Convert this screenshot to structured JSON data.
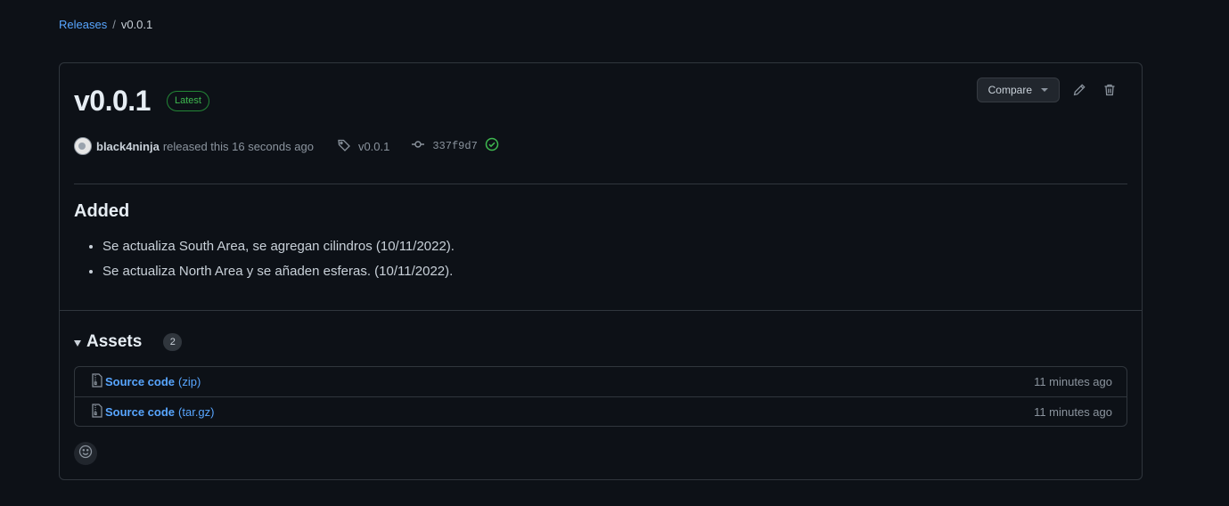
{
  "breadcrumb": {
    "parent": "Releases",
    "separator": "/",
    "current": "v0.0.1"
  },
  "release": {
    "title": "v0.0.1",
    "badge": "Latest",
    "author": "black4ninja",
    "released_text": "released this 16 seconds ago",
    "tag": "v0.0.1",
    "commit": "337f9d7",
    "commit_status": "verified"
  },
  "actions": {
    "compare_label": "Compare",
    "edit_icon": "pencil-icon",
    "delete_icon": "trash-icon"
  },
  "notes": {
    "heading": "Added",
    "items": [
      "Se actualiza South Area, se agregan cilindros (10/11/2022).",
      "Se actualiza North Area y se añaden esferas. (10/11/2022)."
    ]
  },
  "assets": {
    "title": "Assets",
    "count": "2",
    "items": [
      {
        "name": "Source code",
        "ext": "(zip)",
        "time": "11 minutes ago"
      },
      {
        "name": "Source code",
        "ext": "(tar.gz)",
        "time": "11 minutes ago"
      }
    ]
  },
  "colors": {
    "accent": "#58a6ff",
    "success": "#3fb950",
    "background": "#0d1117",
    "border": "#30363d"
  }
}
